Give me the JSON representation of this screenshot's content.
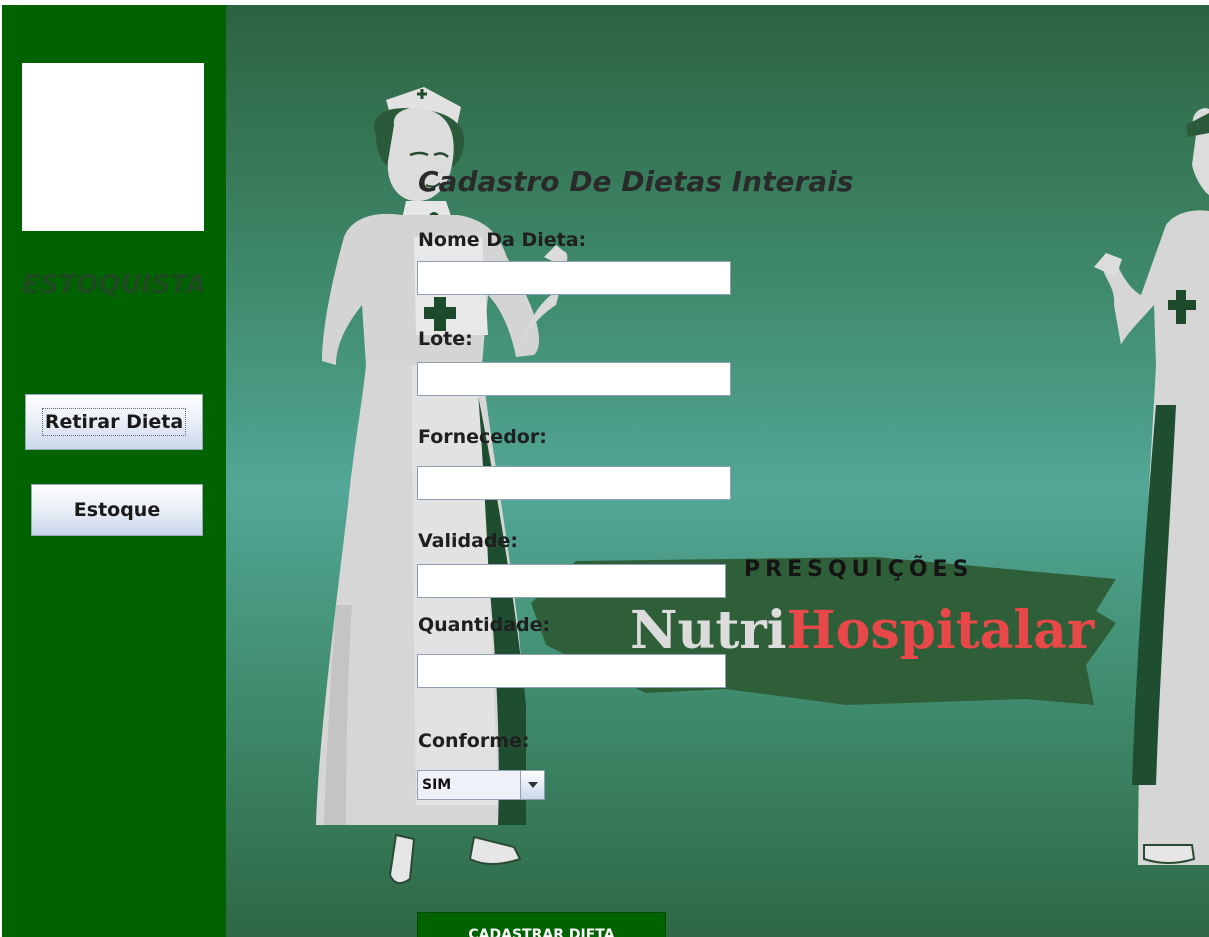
{
  "sidebar": {
    "role_label": "ESTOQUISTA",
    "buttons": [
      {
        "label": "Retirar Dieta"
      },
      {
        "label": "Estoque"
      }
    ]
  },
  "form": {
    "title": "Cadastro De Dietas Interais",
    "fields": [
      {
        "label": "Nome Da Dieta:",
        "value": ""
      },
      {
        "label": "Lote:",
        "value": ""
      },
      {
        "label": "Fornecedor:",
        "value": ""
      },
      {
        "label": "Validade:",
        "value": ""
      },
      {
        "label": "Quantidade:",
        "value": ""
      }
    ],
    "conforme": {
      "label": "Conforme:",
      "selected": "SIM"
    },
    "submit_label": "CADASTRAR DIETA"
  },
  "brand": {
    "subtitle": "PRESQUIÇÕES",
    "name_part1": "Nutri",
    "name_part2": "Hospitalar",
    "color_part1": "#dcdcdc",
    "color_part2": "#e8484a"
  },
  "colors": {
    "sidebar": "#006300",
    "accent": "#006300"
  },
  "icons": {
    "combo_arrow": "chevron-down-icon"
  }
}
